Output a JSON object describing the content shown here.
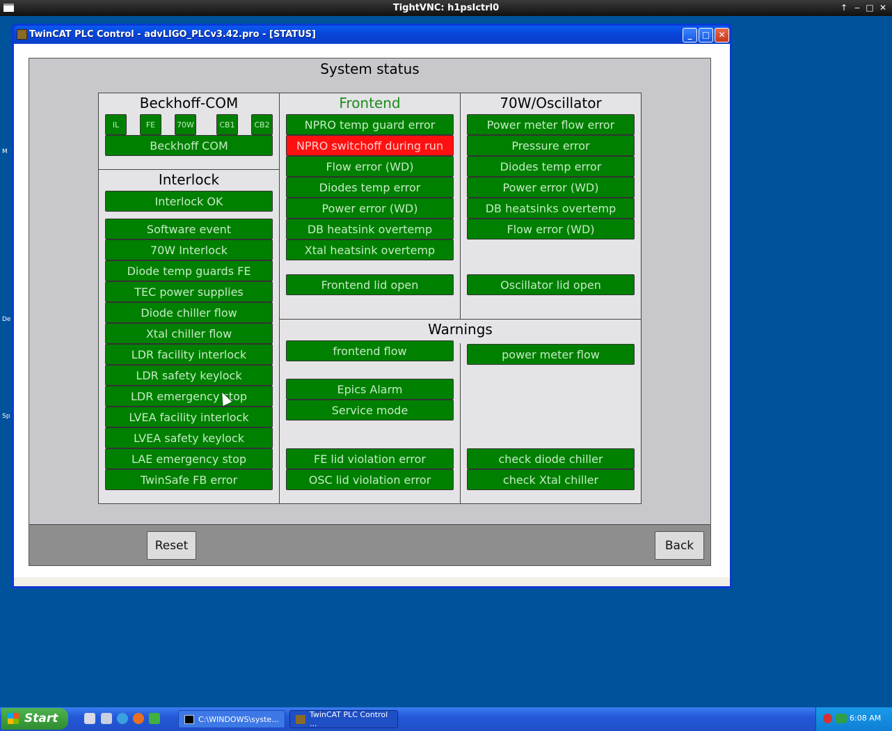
{
  "vnc": {
    "title": "TightVNC: h1psIctrl0"
  },
  "desktop_edge": [
    "M",
    "De",
    "Sp"
  ],
  "window": {
    "title": "TwinCAT PLC Control - advLIGO_PLCv3.42.pro - [STATUS]"
  },
  "panel": {
    "title": "System status",
    "reset_label": "Reset",
    "back_label": "Back",
    "beckhoff": {
      "title": "Beckhoff-COM",
      "small": [
        "IL",
        "FE",
        "70W",
        "CB1",
        "CB2"
      ],
      "main": "Beckhoff COM"
    },
    "interlock": {
      "title": "Interlock",
      "ok": "Interlock OK",
      "items": [
        "Software event",
        "70W Interlock",
        "Diode temp guards FE",
        "TEC power supplies",
        "Diode chiller flow",
        "Xtal chiller flow",
        "LDR facility interlock",
        "LDR safety keylock",
        "LDR emergency stop",
        "LVEA facility interlock",
        "LVEA safety keylock",
        "LAE emergency stop",
        "TwinSafe FB error"
      ]
    },
    "frontend": {
      "title": "Frontend",
      "items": [
        "NPRO temp guard error",
        "NPRO switchoff during run",
        "Flow error (WD)",
        "Diodes temp error",
        "Power error (WD)",
        "DB heatsink overtemp",
        "Xtal heatsink overtemp"
      ],
      "lid": "Frontend lid open"
    },
    "oscillator": {
      "title": "70W/Oscillator",
      "items": [
        "Power meter flow error",
        "Pressure error",
        "Diodes temp error",
        "Power error (WD)",
        "DB heatsinks overtemp",
        "Flow error (WD)"
      ],
      "lid": "Oscillator lid open"
    },
    "warnings": {
      "title": "Warnings",
      "frontend_flow": "frontend flow",
      "power_meter_flow": "power meter flow",
      "epics_alarm": "Epics Alarm",
      "service_mode": "Service mode",
      "fe_lid": "FE lid violation error",
      "osc_lid": "OSC lid violation error",
      "diode_chiller": "check diode chiller",
      "xtal_chiller": "check Xtal chiller"
    },
    "colors": {
      "ok": "#008000",
      "alarm": "#ff1010",
      "frontend_title": "#1a8c1a"
    }
  },
  "taskbar": {
    "start_label": "Start",
    "tasks": [
      "C:\\WINDOWS\\syste...",
      "TwinCAT PLC Control ..."
    ],
    "clock": "6:08 AM"
  }
}
